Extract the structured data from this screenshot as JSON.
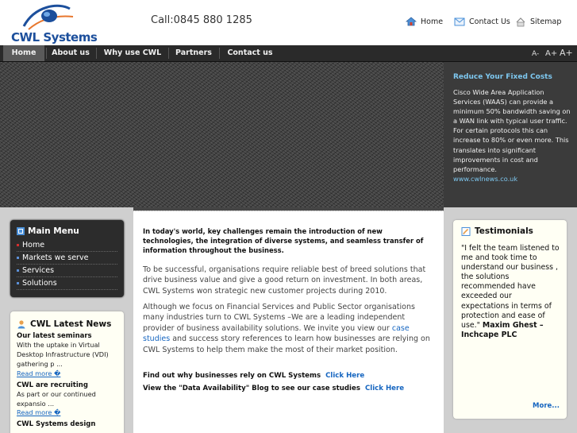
{
  "logo": {
    "brand": "CWL",
    "brand_suffix": "Systems"
  },
  "header": {
    "phone": "Call:0845 880 1285",
    "links": {
      "home": "Home",
      "contact": "Contact Us",
      "sitemap": "Sitemap"
    }
  },
  "nav": {
    "items": [
      "Home",
      "About us",
      "Why use CWL",
      "Partners",
      "Contact us"
    ],
    "font_sizes": [
      "A-",
      "A+",
      "A+"
    ]
  },
  "promo": {
    "title": "Reduce Your Fixed Costs",
    "body": "Cisco Wide Area Application Services (WAAS) can provide a minimum 50% bandwidth saving on a WAN link with typical user traffic. For certain  protocols this can increase to 80% or even more. This translates into significant improvements in cost and performance.",
    "link": "www.cwlnews.co.uk"
  },
  "main_menu": {
    "title": "Main Menu",
    "items": [
      {
        "label": "Home",
        "bullet_color": "#d32f2f"
      },
      {
        "label": "Markets we serve",
        "bullet_color": "#5b8fd6"
      },
      {
        "label": "Services",
        "bullet_color": "#5b8fd6"
      },
      {
        "label": "Solutions",
        "bullet_color": "#5b8fd6"
      }
    ]
  },
  "news": {
    "title": "CWL Latest News",
    "items": [
      {
        "head": "Our latest seminars",
        "text": "With the uptake in Virtual Desktop Infrastructure (VDI) gathering p ...",
        "more": "Read more �"
      },
      {
        "head": "CWL are recruiting",
        "text": "As part or our continued expansio ...",
        "more": "Read more �"
      },
      {
        "head": "CWL Systems design",
        "text": "",
        "more": ""
      }
    ]
  },
  "main": {
    "intro": "In today's world, key challenges remain the introduction of new technologies, the integration of diverse systems, and seamless transfer of information throughout the business.",
    "para1": "To be successful, organisations require reliable best of breed solutions that drive business value and give a good return on investment. In both areas, CWL Systems won strategic new customer projects during 2010.",
    "para2_a": "Although we focus on Financial Services and Public Sector organisations many industries turn to CWL Systems –We are a leading independent provider of business availability solutions. We invite you view our ",
    "para2_link": "case studies",
    "para2_b": " and success story references to learn how businesses are relying on CWL Systems to help them make the most of their market position.",
    "cta1_text": "Find out why businesses rely on CWL Systems",
    "cta1_link": "Click Here",
    "cta2_text": "View the \"Data Availability\" Blog to see our case studies",
    "cta2_link": "Click Here"
  },
  "testimonials": {
    "title": "Testimonials",
    "quote": "\"I felt the team listened to me and took time to understand our business , the solutions recommended have exceeded our expectations in terms of protection and ease of use.\"",
    "author": "Maxim Ghest – Inchcape PLC",
    "more": "More..."
  },
  "colors": {
    "link": "#1565c0",
    "promo_title": "#7ec8f0",
    "nav_bg": "#2a2a2a",
    "brand": "#1c4f9c"
  }
}
